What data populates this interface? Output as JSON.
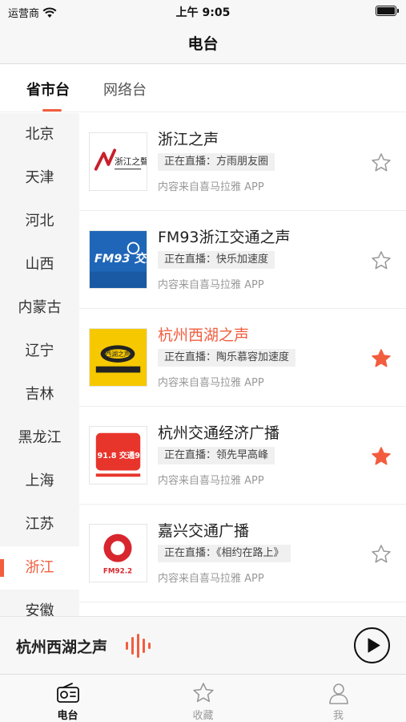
{
  "status_bar": {
    "carrier": "运营商",
    "time": "上午 9:05"
  },
  "header": {
    "title": "电台"
  },
  "tabs": [
    {
      "label": "省市台",
      "active": true
    },
    {
      "label": "网络台",
      "active": false
    }
  ],
  "sidebar": {
    "items": [
      {
        "label": "北京"
      },
      {
        "label": "天津"
      },
      {
        "label": "河北"
      },
      {
        "label": "山西"
      },
      {
        "label": "内蒙古"
      },
      {
        "label": "辽宁"
      },
      {
        "label": "吉林"
      },
      {
        "label": "黑龙江"
      },
      {
        "label": "上海"
      },
      {
        "label": "江苏"
      },
      {
        "label": "浙江",
        "active": true
      },
      {
        "label": "安徽"
      }
    ]
  },
  "stations": [
    {
      "name": "浙江之声",
      "live": "正在直播：方雨朋友圈",
      "source": "内容来自喜马拉雅 APP",
      "favorited": false,
      "playing": false,
      "logo_label": "浙江之聲"
    },
    {
      "name": "FM93浙江交通之声",
      "live": "正在直播：快乐加速度",
      "source": "内容来自喜马拉雅 APP",
      "favorited": false,
      "playing": false,
      "logo_label": "FM93 交通之声"
    },
    {
      "name": "杭州西湖之声",
      "live": "正在直播：陶乐慕容加速度",
      "source": "内容来自喜马拉雅 APP",
      "favorited": true,
      "playing": true,
      "logo_label": "西湖之声"
    },
    {
      "name": "杭州交通经济广播",
      "live": "正在直播：领先早高峰",
      "source": "内容来自喜马拉雅 APP",
      "favorited": true,
      "playing": false,
      "logo_label": "FM 91.8 交通91.8"
    },
    {
      "name": "嘉兴交通广播",
      "live": "正在直播：《相约在路上》",
      "source": "内容来自喜马拉雅 APP",
      "favorited": false,
      "playing": false,
      "logo_label": "FM92.2"
    }
  ],
  "player": {
    "now_playing": "杭州西湖之声",
    "state": "paused"
  },
  "tab_bar": {
    "items": [
      {
        "label": "电台",
        "icon": "radio-icon",
        "active": true
      },
      {
        "label": "收藏",
        "icon": "star-icon",
        "active": false
      },
      {
        "label": "我",
        "icon": "person-icon",
        "active": false
      }
    ]
  },
  "colors": {
    "accent": "#f25d3e",
    "star_active": "#f25d3e",
    "star_inactive": "#999999"
  }
}
